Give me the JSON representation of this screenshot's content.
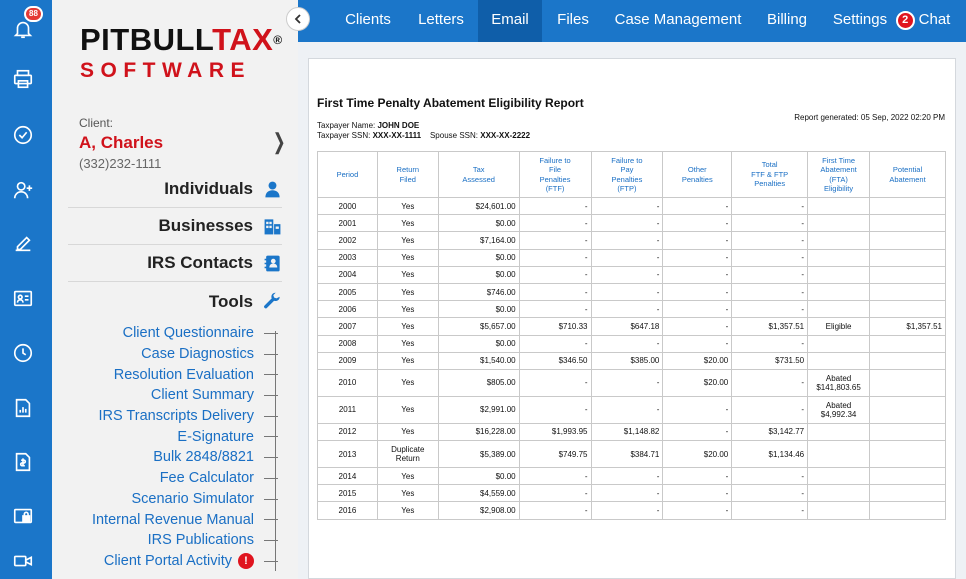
{
  "rail": {
    "notification_count": "88",
    "icons": [
      "bell-icon",
      "printer-icon",
      "check-circle-icon",
      "add-user-icon",
      "edit-icon",
      "contact-card-icon",
      "clock-icon",
      "report-chart-icon",
      "invoice-icon",
      "lock-screen-icon",
      "video-icon"
    ]
  },
  "logo": {
    "top_a": "PITBULL",
    "top_b": "TAX",
    "reg": "®",
    "bottom": "SOFTWARE"
  },
  "client": {
    "label": "Client:",
    "name": "A, Charles",
    "phone": "(332)232-1111"
  },
  "sections": [
    {
      "label": "Individuals",
      "icon": "person-icon"
    },
    {
      "label": "Businesses",
      "icon": "building-icon"
    },
    {
      "label": "IRS Contacts",
      "icon": "address-book-icon"
    },
    {
      "label": "Tools",
      "icon": "wrench-icon"
    }
  ],
  "tools": [
    "Client Questionnaire",
    "Case Diagnostics",
    "Resolution Evaluation",
    "Client Summary",
    "IRS Transcripts Delivery",
    "E-Signature",
    "Bulk 2848/8821",
    "Fee Calculator",
    "Scenario Simulator",
    "Internal Revenue Manual",
    "IRS Publications",
    "Client Portal Activity"
  ],
  "tools_alert": "!",
  "nav": {
    "items": [
      "Clients",
      "Letters",
      "Email",
      "Files",
      "Case Management",
      "Billing",
      "Settings"
    ],
    "active": "Email",
    "chat_count": "2",
    "chat_label": "Chat"
  },
  "report": {
    "title": "First Time Penalty Abatement Eligibility Report",
    "taxpayer_name_label": "Taxpayer Name:",
    "taxpayer_name": "JOHN DOE",
    "ssn_label": "Taxpayer SSN:",
    "ssn": "XXX-XX-1111",
    "spouse_ssn_label": "Spouse SSN:",
    "spouse_ssn": "XXX-XX-2222",
    "generated": "Report generated: 05 Sep, 2022 02:20 PM",
    "headers": [
      "Period",
      "Return\nFiled",
      "Tax\nAssessed",
      "Failure to\nFile\nPenalties\n(FTF)",
      "Failure to\nPay\nPenalties\n(FTP)",
      "Other\nPenalties",
      "Total\nFTF & FTP\nPenalties",
      "First Time\nAbatement\n(FTA)\nEligibility",
      "Potential\nAbatement"
    ],
    "rows": [
      [
        "2000",
        "Yes",
        "$24,601.00",
        "-",
        "-",
        "-",
        "-",
        "",
        ""
      ],
      [
        "2001",
        "Yes",
        "$0.00",
        "-",
        "-",
        "-",
        "-",
        "",
        ""
      ],
      [
        "2002",
        "Yes",
        "$7,164.00",
        "-",
        "-",
        "-",
        "-",
        "",
        ""
      ],
      [
        "2003",
        "Yes",
        "$0.00",
        "-",
        "-",
        "-",
        "-",
        "",
        ""
      ],
      [
        "2004",
        "Yes",
        "$0.00",
        "-",
        "-",
        "-",
        "-",
        "",
        ""
      ],
      [
        "2005",
        "Yes",
        "$746.00",
        "-",
        "-",
        "-",
        "-",
        "",
        ""
      ],
      [
        "2006",
        "Yes",
        "$0.00",
        "-",
        "-",
        "-",
        "-",
        "",
        ""
      ],
      [
        "2007",
        "Yes",
        "$5,657.00",
        "$710.33",
        "$647.18",
        "-",
        "$1,357.51",
        "Eligible",
        "$1,357.51"
      ],
      [
        "2008",
        "Yes",
        "$0.00",
        "-",
        "-",
        "-",
        "-",
        "",
        ""
      ],
      [
        "2009",
        "Yes",
        "$1,540.00",
        "$346.50",
        "$385.00",
        "$20.00",
        "$731.50",
        "",
        ""
      ],
      [
        "2010",
        "Yes",
        "$805.00",
        "-",
        "-",
        "$20.00",
        "-",
        "Abated\n$141,803.65",
        ""
      ],
      [
        "2011",
        "Yes",
        "$2,991.00",
        "-",
        "-",
        "-",
        "-",
        "Abated\n$4,992.34",
        ""
      ],
      [
        "2012",
        "Yes",
        "$16,228.00",
        "$1,993.95",
        "$1,148.82",
        "-",
        "$3,142.77",
        "",
        ""
      ],
      [
        "2013",
        "Duplicate\nReturn",
        "$5,389.00",
        "$749.75",
        "$384.71",
        "$20.00",
        "$1,134.46",
        "",
        ""
      ],
      [
        "2014",
        "Yes",
        "$0.00",
        "-",
        "-",
        "-",
        "-",
        "",
        ""
      ],
      [
        "2015",
        "Yes",
        "$4,559.00",
        "-",
        "-",
        "-",
        "-",
        "",
        ""
      ],
      [
        "2016",
        "Yes",
        "$2,908.00",
        "-",
        "-",
        "-",
        "-",
        "",
        ""
      ]
    ]
  },
  "colors": {
    "brand_blue": "#1b76c9",
    "brand_red": "#d0121b",
    "eligible_green": "#1a9e2e",
    "link_blue": "#1a6fc4"
  }
}
